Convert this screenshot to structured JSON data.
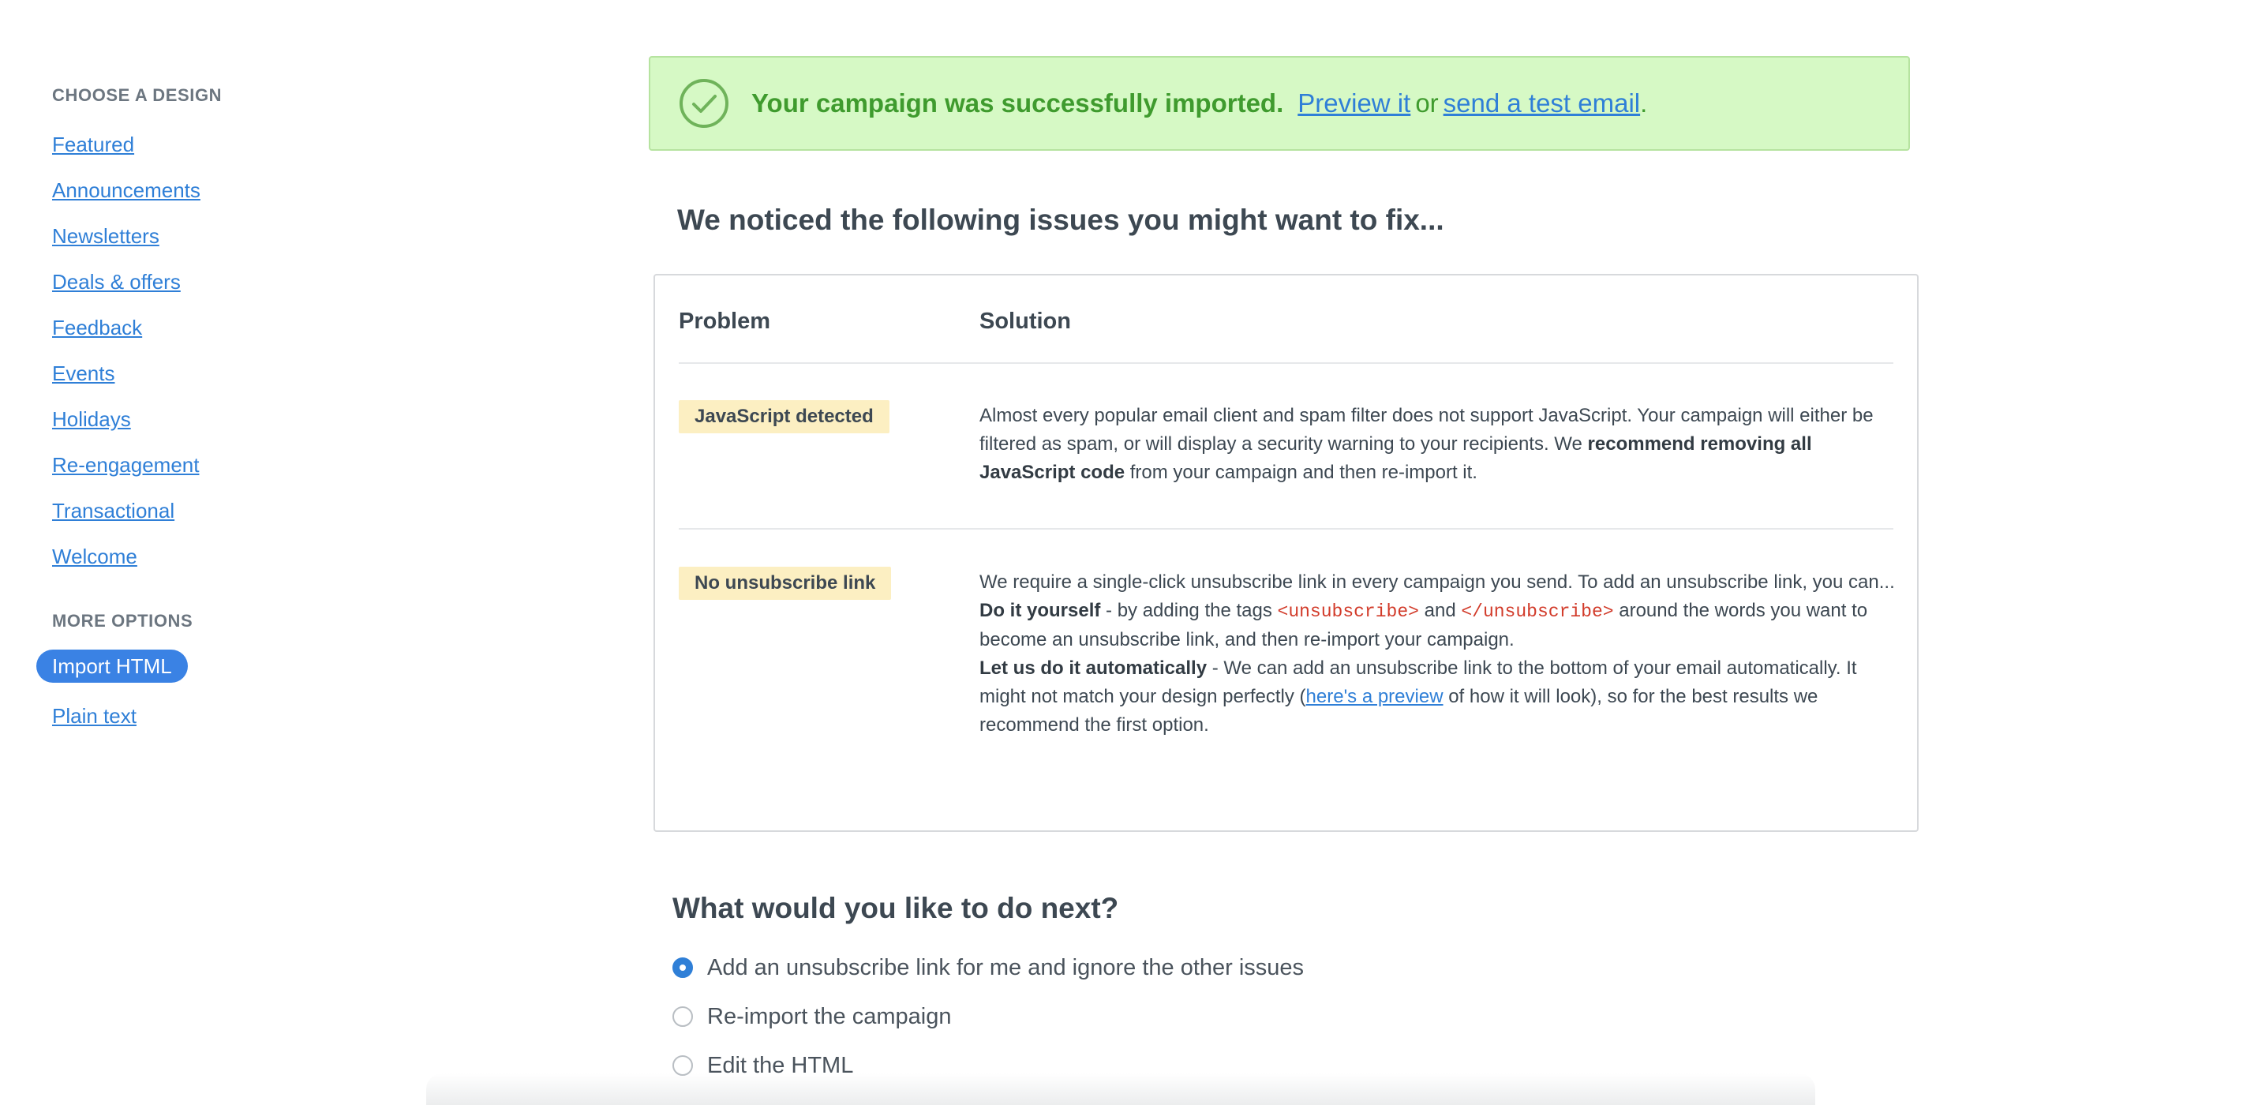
{
  "sidebar": {
    "design_heading": "CHOOSE A DESIGN",
    "design_items": [
      {
        "label": "Featured"
      },
      {
        "label": "Announcements"
      },
      {
        "label": "Newsletters"
      },
      {
        "label": "Deals & offers"
      },
      {
        "label": "Feedback"
      },
      {
        "label": "Events"
      },
      {
        "label": "Holidays"
      },
      {
        "label": "Re-engagement"
      },
      {
        "label": "Transactional"
      },
      {
        "label": "Welcome"
      }
    ],
    "options_heading": "MORE OPTIONS",
    "option_items": [
      {
        "label": "Import HTML",
        "active": true
      },
      {
        "label": "Plain text",
        "active": false
      }
    ]
  },
  "banner": {
    "icon": "check-circle-icon",
    "message": "Your campaign was successfully imported.",
    "preview_link": "Preview it",
    "or_text": "or",
    "test_email_link": "send a test email",
    "period": "."
  },
  "issues": {
    "heading": "We noticed the following issues you might want to fix...",
    "col_problem": "Problem",
    "col_solution": "Solution",
    "rows": [
      {
        "problem": "JavaScript detected",
        "solution_1": "Almost every popular email client and spam filter does not support JavaScript. Your campaign will either be filtered as spam, or will display a security warning to your recipients. We ",
        "solution_bold": "recommend removing all JavaScript code",
        "solution_2": " from your campaign and then re-import it."
      },
      {
        "problem": "No unsubscribe link",
        "intro": "We require a single-click unsubscribe link in every campaign you send. To add an unsubscribe link, you can...",
        "diy_bold": "Do it yourself",
        "diy_1": " - by adding the tags ",
        "tag_open": "<unsubscribe>",
        "diy_and": " and ",
        "tag_close": "</unsubscribe>",
        "diy_2": " around the words you want to become an unsubscribe link, and then re-import your campaign.",
        "auto_bold": "Let us do it automatically",
        "auto_1": " - We can add an unsubscribe link to the bottom of your email automatically. It might not match your design perfectly (",
        "preview_link": "here's a preview",
        "auto_2": " of how it will look), so for the best results we recommend the first option."
      }
    ]
  },
  "next": {
    "heading": "What would you like to do next?",
    "options": [
      {
        "label": "Add an unsubscribe link for me and ignore the other issues",
        "checked": true
      },
      {
        "label": "Re-import the campaign",
        "checked": false
      },
      {
        "label": "Edit the HTML",
        "checked": false
      }
    ]
  },
  "colors": {
    "link": "#2f7fd7",
    "banner_bg": "#d6f9c5",
    "banner_text": "#3f9b2e",
    "badge_bg": "#fcefc2",
    "code": "#d23b2a",
    "active_pill": "#3a82e4"
  }
}
